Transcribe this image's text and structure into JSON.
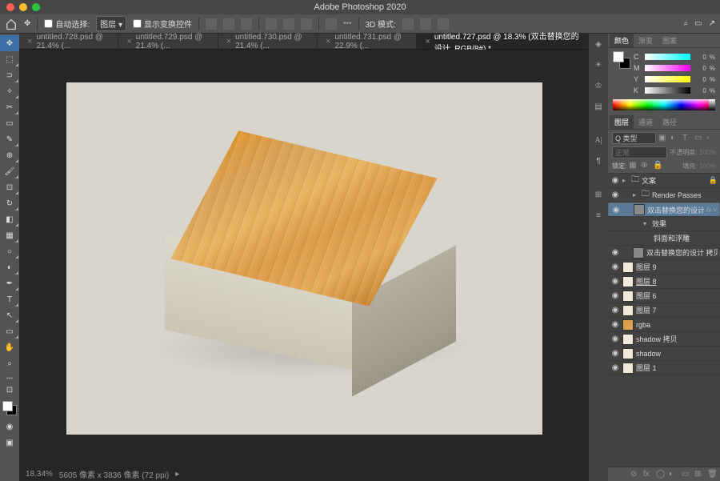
{
  "app": {
    "title": "Adobe Photoshop 2020"
  },
  "optbar": {
    "auto_select": "自动选择:",
    "layer_sel": "图层",
    "show_transform": "显示变换控件",
    "mode3d": "3D 模式:"
  },
  "tabs": [
    {
      "label": "untitled.728.psd @ 21.4% (...",
      "active": false
    },
    {
      "label": "untitled.729.psd @ 21.4% (...",
      "active": false
    },
    {
      "label": "untitled.730.psd @ 21.4% (...",
      "active": false
    },
    {
      "label": "untitled.731.psd @ 22.9% (...",
      "active": false
    },
    {
      "label": "untitled.727.psd @ 18.3% (双击替换您的设计, RGB/8#) *",
      "active": true
    }
  ],
  "status": {
    "zoom": "18.34%",
    "info": "5605 像素 x 3836 像素 (72 ppi)"
  },
  "color_tabs": {
    "t1": "颜色",
    "t2": "渐变",
    "t3": "图案"
  },
  "sliders": {
    "c": {
      "lbl": "C",
      "val": "0"
    },
    "m": {
      "lbl": "M",
      "val": "0"
    },
    "y": {
      "lbl": "Y",
      "val": "0"
    },
    "k": {
      "lbl": "K",
      "val": "0"
    },
    "pct": "%"
  },
  "layer_tabs": {
    "t1": "图层",
    "t2": "通道",
    "t3": "路径"
  },
  "layer_ctrl": {
    "kind": "Q 类型",
    "normal": "正常",
    "opacity_lbl": "不透明度:",
    "opacity_val": "100%",
    "lock": "锁定:",
    "fill_lbl": "填充:",
    "fill_val": "100%"
  },
  "layers": [
    {
      "name": "文案",
      "type": "folder",
      "indent": 0,
      "locked": true
    },
    {
      "name": "Render Passes",
      "type": "folder",
      "indent": 1
    },
    {
      "name": "双击替换您的设计",
      "type": "smart",
      "indent": 1,
      "fx": true,
      "sel": true
    },
    {
      "name": "效果",
      "type": "fx",
      "indent": 2
    },
    {
      "name": "斜面和浮雕",
      "type": "fxi",
      "indent": 3
    },
    {
      "name": "双击替换您的设计 拷贝",
      "type": "smart",
      "indent": 1
    },
    {
      "name": "图层 9",
      "type": "layer",
      "indent": 0,
      "thumb": "w"
    },
    {
      "name": "图层 8",
      "type": "layer",
      "indent": 0,
      "thumb": "w",
      "ul": true
    },
    {
      "name": "图层 6",
      "type": "layer",
      "indent": 0,
      "thumb": "w"
    },
    {
      "name": "图层 7",
      "type": "layer",
      "indent": 0,
      "thumb": "w"
    },
    {
      "name": "rgba",
      "type": "layer",
      "indent": 0,
      "thumb": "wd"
    },
    {
      "name": "shadow 拷贝",
      "type": "layer",
      "indent": 0,
      "thumb": "w"
    },
    {
      "name": "shadow",
      "type": "layer",
      "indent": 0,
      "thumb": "w"
    },
    {
      "name": "图层 1",
      "type": "layer",
      "indent": 0,
      "thumb": "w"
    }
  ]
}
